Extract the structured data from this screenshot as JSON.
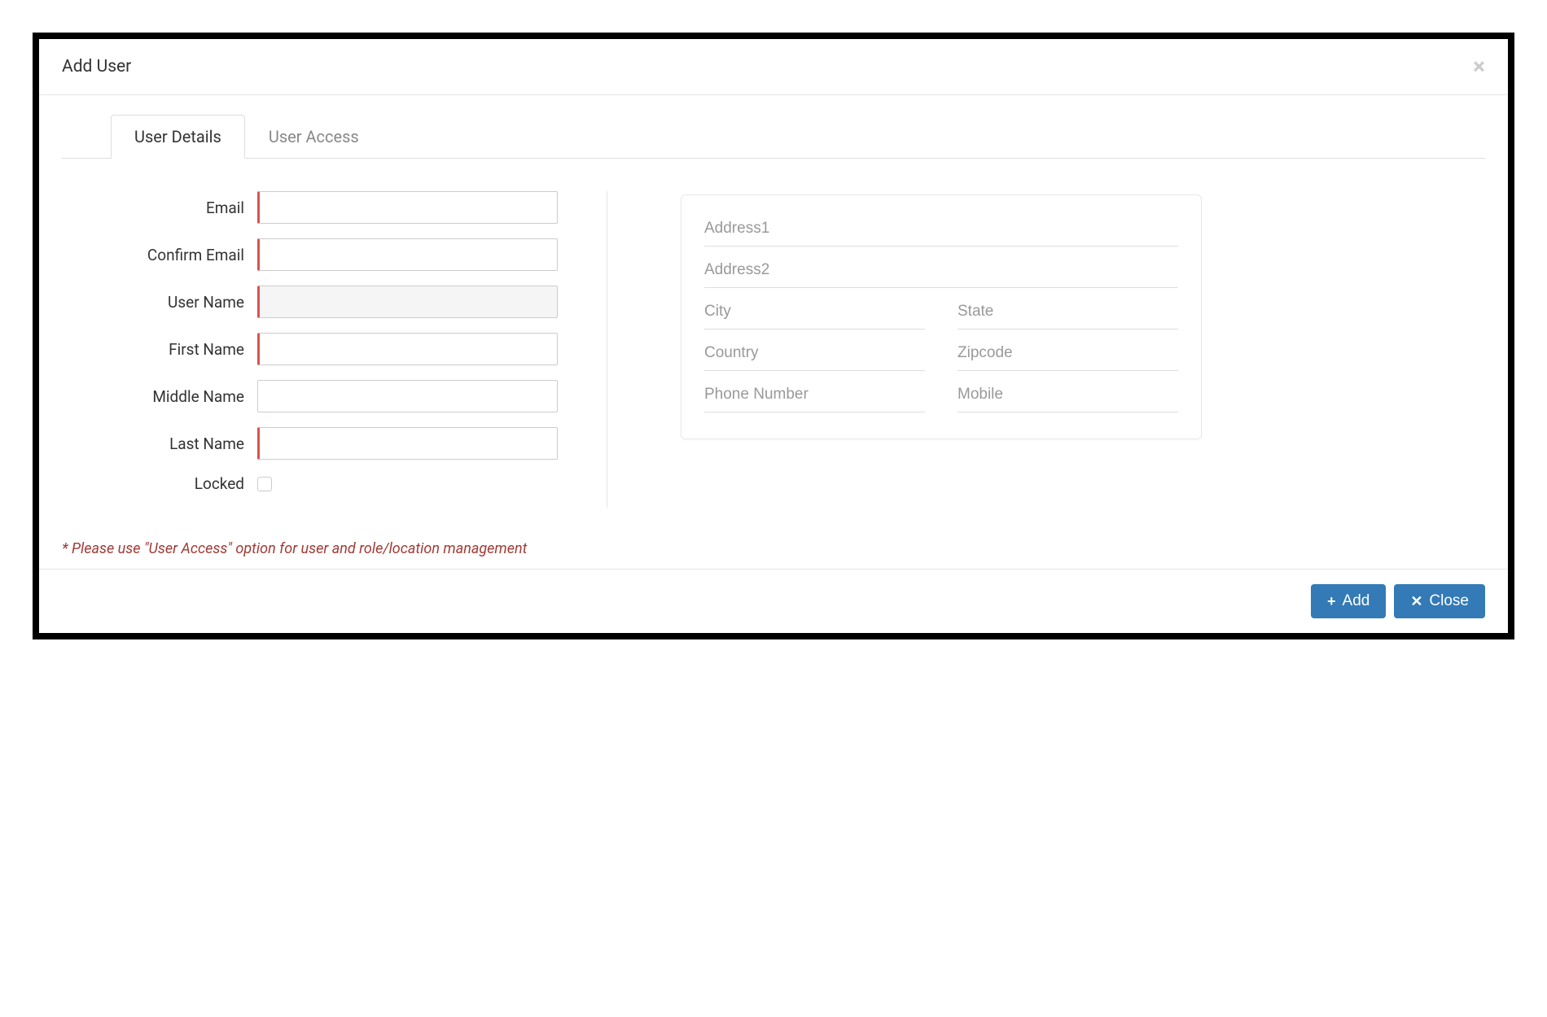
{
  "modal": {
    "title": "Add User",
    "close_icon": "×",
    "tabs": {
      "user_details": "User Details",
      "user_access": "User Access"
    },
    "note": "* Please use \"User Access\" option for user and role/location management"
  },
  "form": {
    "labels": {
      "email": "Email",
      "confirm_email": "Confirm Email",
      "user_name": "User Name",
      "first_name": "First Name",
      "middle_name": "Middle Name",
      "last_name": "Last Name",
      "locked": "Locked"
    },
    "values": {
      "email": "",
      "confirm_email": "",
      "user_name": "",
      "first_name": "",
      "middle_name": "",
      "last_name": "",
      "locked": false
    }
  },
  "address": {
    "placeholders": {
      "address1": "Address1",
      "address2": "Address2",
      "city": "City",
      "state": "State",
      "country": "Country",
      "zipcode": "Zipcode",
      "phone": "Phone Number",
      "mobile": "Mobile"
    },
    "values": {
      "address1": "",
      "address2": "",
      "city": "",
      "state": "",
      "country": "",
      "zipcode": "",
      "phone": "",
      "mobile": ""
    }
  },
  "footer": {
    "add_label": "Add",
    "close_label": "Close",
    "plus_icon": "+",
    "x_icon": "✕"
  }
}
